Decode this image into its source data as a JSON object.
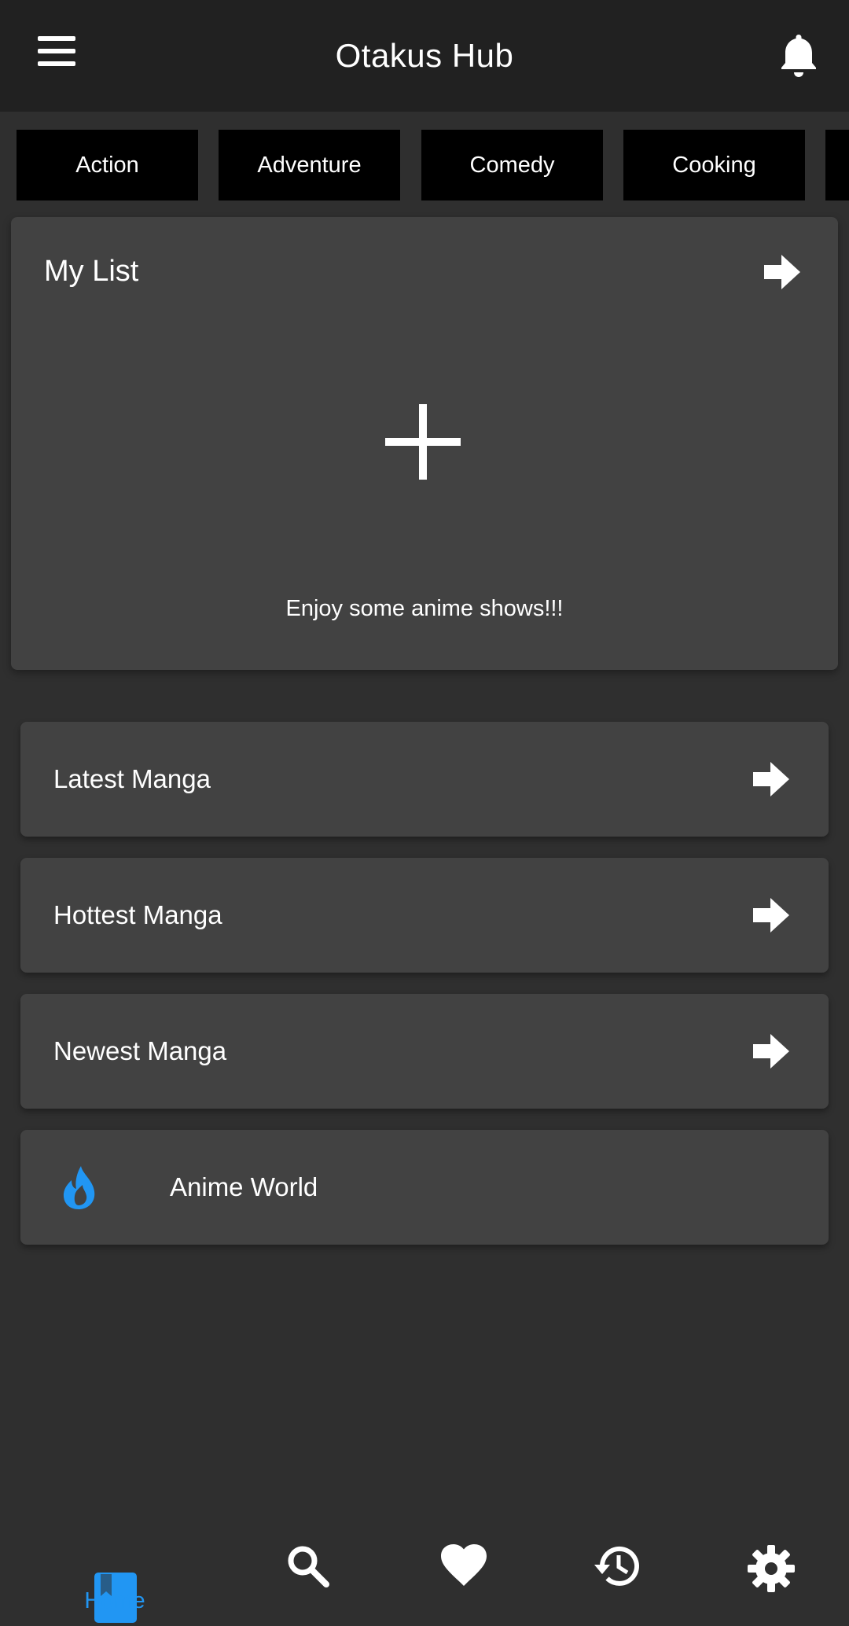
{
  "header": {
    "title": "Otakus Hub",
    "menu_icon": "menu-icon",
    "notification_icon": "bell-icon"
  },
  "genres": [
    "Action",
    "Adventure",
    "Comedy",
    "Cooking",
    ""
  ],
  "my_list": {
    "title": "My List",
    "caption": "Enjoy some anime shows!!!",
    "add_icon": "plus-icon",
    "open_icon": "arrow-right-icon"
  },
  "sections": [
    {
      "label": "Latest Manga",
      "icon": "arrow-right-icon"
    },
    {
      "label": "Hottest Manga",
      "icon": "arrow-right-icon"
    },
    {
      "label": "Newest Manga",
      "icon": "arrow-right-icon"
    }
  ],
  "anime_world": {
    "label": "Anime World",
    "icon": "flame-icon"
  },
  "bottom_nav": {
    "home_label": "Home",
    "active": "home",
    "items": [
      "home",
      "search",
      "favorites",
      "history",
      "settings"
    ]
  },
  "colors": {
    "background": "#2f2f2f",
    "header": "#212121",
    "card": "#424242",
    "genre_chip": "#000000",
    "accent": "#2196f3",
    "text": "#ffffff"
  }
}
